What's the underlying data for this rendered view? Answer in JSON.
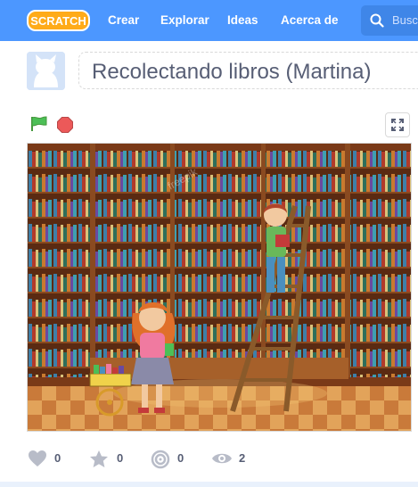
{
  "navbar": {
    "logo_text": "SCRATCH",
    "links": [
      "Crear",
      "Explorar",
      "Ideas",
      "Acerca de"
    ],
    "search_placeholder": "Busc"
  },
  "project": {
    "title": "Recolectando libros (Martina)"
  },
  "stage": {
    "watermark": "freepik"
  },
  "stats": {
    "loves": "0",
    "favorites": "0",
    "remixes": "0",
    "views": "2"
  },
  "colors": {
    "nav": "#4c97ff",
    "flag": "#4cbf56",
    "stop": "#ec5959",
    "text": "#575e75"
  }
}
